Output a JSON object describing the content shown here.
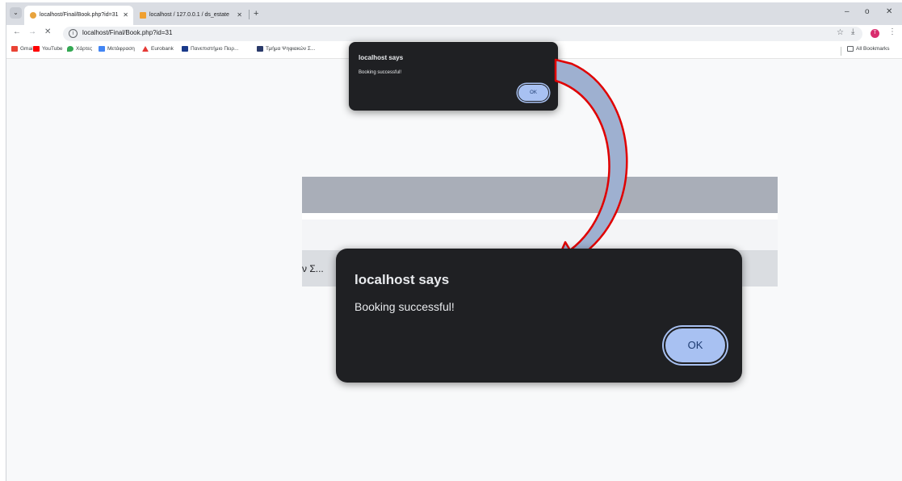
{
  "tabs": [
    {
      "title": "localhost/Final/Book.php?id=31",
      "active": true,
      "favicon_color": "#e8a33d"
    },
    {
      "title": "localhost / 127.0.0.1 / ds_estate",
      "active": false,
      "favicon_color": "#f0a030"
    }
  ],
  "new_tab_label": "+",
  "window_controls": {
    "minimize": "–",
    "restore": "o",
    "close": "✕"
  },
  "toolbar": {
    "back_icon": "←",
    "forward_icon": "→",
    "stop_icon": "✕",
    "url": "localhost/Final/Book.php?id=31",
    "star_icon": "☆",
    "download_icon": "⤓",
    "profile_initial": "T",
    "menu_icon": "⋮"
  },
  "bookmarks": [
    {
      "label": "Gmail",
      "color": "#ea4335"
    },
    {
      "label": "YouTube",
      "color": "#ff0000"
    },
    {
      "label": "Χάρτες",
      "color": "#34a853"
    },
    {
      "label": "Μετάφραση",
      "color": "#4285f4"
    },
    {
      "label": "Eurobank",
      "color": "#e53935"
    },
    {
      "label": "Πανεπιστήμιο Πειρ...",
      "color": "#1a3a8a"
    },
    {
      "label": "Τμήμα Ψηφιακών Σ...",
      "color": "#2a3a6a"
    }
  ],
  "all_bookmarks": "All Bookmarks",
  "page": {
    "truncated_text": "ν Σ..."
  },
  "dialog": {
    "title": "localhost says",
    "message": "Booking successful!",
    "ok_label": "OK"
  },
  "colors": {
    "dialog_bg": "#1f2023",
    "ok_button": "#a8c1f2",
    "arrow_fill": "#9eb0d0",
    "arrow_stroke": "#e00000"
  }
}
